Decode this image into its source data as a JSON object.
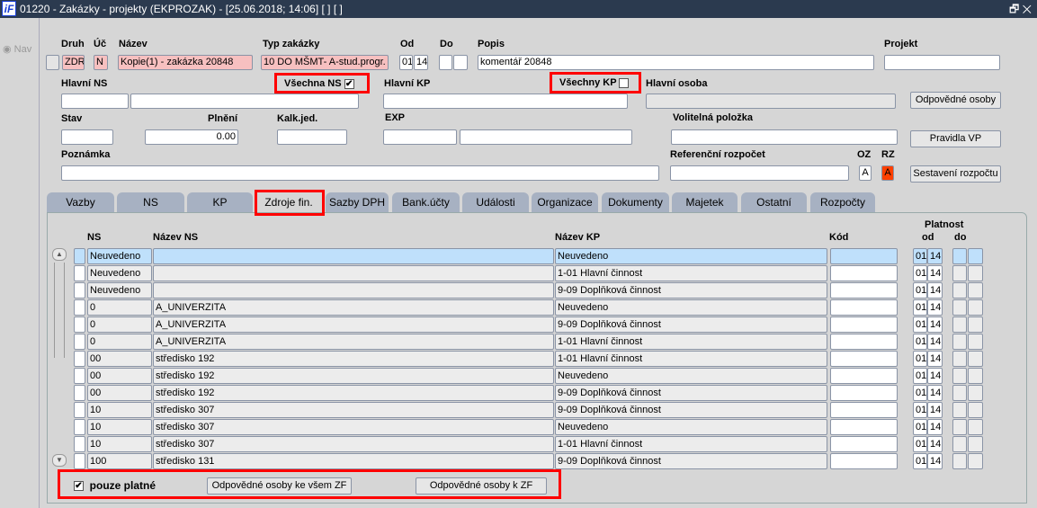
{
  "window": {
    "logo": "iF",
    "title": "01220 - Zakázky - projekty (EKPROZAK) - [25.06.2018; 14:06]  [ ]  [ ]",
    "controls": "🗗 ✕"
  },
  "nav": {
    "label": "Nav"
  },
  "header": {
    "druh_label": "Druh",
    "uc_label": "Úč",
    "nazev_label": "Název",
    "typ_label": "Typ zakázky",
    "od_label": "Od",
    "do_label": "Do",
    "popis_label": "Popis",
    "projekt_label": "Projekt",
    "druh": "ZDR",
    "uc": "N",
    "nazev": "Kopie(1) - zakázka 20848",
    "typ": "10 DO MŠMT- A-stud.progr.",
    "od_1": "01",
    "od_2": "14",
    "popis": "komentář 20848",
    "hlavni_ns_label": "Hlavní NS",
    "vsechna_ns_label": "Všechna NS",
    "vsechna_ns_checked": true,
    "hlavni_kp_label": "Hlavní KP",
    "vsechny_kp_label": "Všechny KP",
    "vsechny_kp_checked": false,
    "hlavni_osoba_label": "Hlavní osoba",
    "odpovedne_osoby_btn": "Odpovědné osoby",
    "stav_label": "Stav",
    "plneni_label": "Plnění",
    "plneni": "0.00",
    "kalk_label": "Kalk.jed.",
    "exp_label": "EXP",
    "volitelna_label": "Volitelná položka",
    "pravidla_btn": "Pravidla VP",
    "poznamka_label": "Poznámka",
    "ref_rozpocet_label": "Referenční rozpočet",
    "oz_label": "OZ",
    "rz_label": "RZ",
    "oz": "A",
    "rz": "A",
    "sestaveni_btn": "Sestavení rozpočtu",
    "rz_color": "#ff4000"
  },
  "tabs": [
    "Vazby",
    "NS",
    "KP",
    "Zdroje fin.",
    "Sazby DPH",
    "Bank.účty",
    "Události",
    "Organizace",
    "Dokumenty",
    "Majetek",
    "Ostatní",
    "Rozpočty"
  ],
  "active_tab": "Zdroje fin.",
  "grid": {
    "headers": {
      "ns": "NS",
      "nazev_ns": "Název NS",
      "nazev_kp": "Název KP",
      "kod": "Kód",
      "platnost": "Platnost",
      "od": "od",
      "do": "do"
    },
    "rows": [
      {
        "ns": "Neuvedeno",
        "nazev_ns": "",
        "nazev_kp": "Neuvedeno",
        "od1": "01",
        "od2": "14"
      },
      {
        "ns": "Neuvedeno",
        "nazev_ns": "",
        "nazev_kp": "1-01 Hlavní činnost",
        "od1": "01",
        "od2": "14"
      },
      {
        "ns": "Neuvedeno",
        "nazev_ns": "",
        "nazev_kp": "9-09 Doplňková činnost",
        "od1": "01",
        "od2": "14"
      },
      {
        "ns": "0",
        "nazev_ns": "A_UNIVERZITA",
        "nazev_kp": "Neuvedeno",
        "od1": "01",
        "od2": "14"
      },
      {
        "ns": "0",
        "nazev_ns": "A_UNIVERZITA",
        "nazev_kp": "9-09 Doplňková činnost",
        "od1": "01",
        "od2": "14"
      },
      {
        "ns": "0",
        "nazev_ns": "A_UNIVERZITA",
        "nazev_kp": "1-01 Hlavní činnost",
        "od1": "01",
        "od2": "14"
      },
      {
        "ns": "00",
        "nazev_ns": "středisko 192",
        "nazev_kp": "1-01 Hlavní činnost",
        "od1": "01",
        "od2": "14"
      },
      {
        "ns": "00",
        "nazev_ns": "středisko 192",
        "nazev_kp": "Neuvedeno",
        "od1": "01",
        "od2": "14"
      },
      {
        "ns": "00",
        "nazev_ns": "středisko 192",
        "nazev_kp": "9-09 Doplňková činnost",
        "od1": "01",
        "od2": "14"
      },
      {
        "ns": "10",
        "nazev_ns": "středisko 307",
        "nazev_kp": "9-09 Doplňková činnost",
        "od1": "01",
        "od2": "14"
      },
      {
        "ns": "10",
        "nazev_ns": "středisko 307",
        "nazev_kp": "Neuvedeno",
        "od1": "01",
        "od2": "14"
      },
      {
        "ns": "10",
        "nazev_ns": "středisko 307",
        "nazev_kp": "1-01 Hlavní činnost",
        "od1": "01",
        "od2": "14"
      },
      {
        "ns": "100",
        "nazev_ns": "středisko 131",
        "nazev_kp": "9-09 Doplňková činnost",
        "od1": "01",
        "od2": "14"
      }
    ]
  },
  "footer": {
    "pouze_platne_label": "pouze platné",
    "pouze_platne_checked": true,
    "btn_vsem": "Odpovědné osoby ke všem ZF",
    "btn_zf": "Odpovědné osoby k ZF"
  }
}
